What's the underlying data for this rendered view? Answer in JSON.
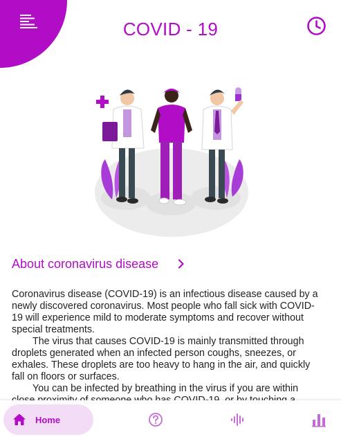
{
  "header": {
    "title": "COVID - 19",
    "menu_icon": "menu-lines-icon",
    "history_icon": "clock-icon"
  },
  "section": {
    "title": "About coronavirus disease",
    "chevron_icon": "chevron-right-icon"
  },
  "article": {
    "paragraphs": [
      "Coronavirus disease (COVID-19) is an infectious disease caused by a newly discovered coronavirus.  Most people who fall sick with COVID-19 will experience mild to moderate symptoms and recover without special treatments.",
      "The virus that causes COVID-19 is mainly transmitted through droplets generated when an infected person coughs, sneezes, or exhales. These droplets are too heavy to hang in the air, and quickly fall on floors or surfaces.",
      "You can be infected by breathing in the virus if you are within close proximity of someone who has COVID-19, or by touching a"
    ]
  },
  "bottom_nav": {
    "home_label": "Home",
    "items": [
      "home-icon",
      "help-circle-icon",
      "audio-wave-icon",
      "bar-chart-icon"
    ]
  },
  "colors": {
    "accent": "#b10cc6",
    "accent_light": "#f3dcf6",
    "text": "#222222"
  }
}
